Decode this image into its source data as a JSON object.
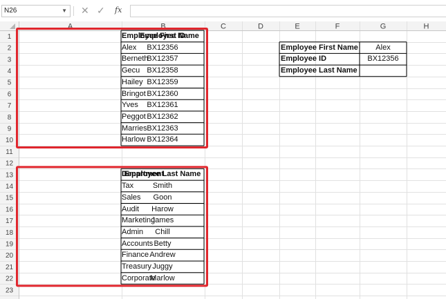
{
  "formula_bar": {
    "name_box": "N26",
    "cancel_icon": "x-icon",
    "enter_icon": "check-icon",
    "function_label": "fx",
    "formula_value": ""
  },
  "sheet": {
    "columns": [
      "A",
      "B",
      "C",
      "D",
      "E",
      "F",
      "G",
      "H"
    ],
    "rows": [
      "1",
      "2",
      "3",
      "4",
      "5",
      "6",
      "7",
      "8",
      "9",
      "10",
      "11",
      "12",
      "13",
      "14",
      "15",
      "16",
      "17",
      "18",
      "19",
      "20",
      "21",
      "22",
      "23"
    ],
    "table1": {
      "headers": [
        "Employee First Name",
        "Employee ID"
      ],
      "rows": [
        [
          "Alex",
          "BX12356"
        ],
        [
          "Berneth",
          "BX12357"
        ],
        [
          "Gecu",
          "BX12358"
        ],
        [
          "Hailey",
          "BX12359"
        ],
        [
          "Bringot",
          "BX12360"
        ],
        [
          "Yves",
          "BX12361"
        ],
        [
          "Peggot",
          "BX12362"
        ],
        [
          "Marries",
          "BX12363"
        ],
        [
          "Harlow",
          "BX12364"
        ]
      ]
    },
    "table2": {
      "headers": [
        "Department",
        "Employee Last Name"
      ],
      "rows": [
        [
          "Tax",
          "Smith"
        ],
        [
          "Sales",
          "Goon"
        ],
        [
          "Audit",
          "Harow"
        ],
        [
          "Marketing",
          "James"
        ],
        [
          "Admin",
          "Chill"
        ],
        [
          "Accounts",
          "Betty"
        ],
        [
          "Finance",
          "Andrew"
        ],
        [
          "Treasury",
          "Juggy"
        ],
        [
          "Corporate",
          "Marlow"
        ]
      ]
    },
    "lookup": {
      "rows": [
        [
          "Employee First Name",
          "Alex"
        ],
        [
          "Employee ID",
          "BX12356"
        ],
        [
          "Employee Last Name",
          ""
        ]
      ]
    },
    "colors": {
      "highlight_border": "#e0262d",
      "table_border": "#000000",
      "gridline": "#e1e1e1",
      "header_bg": "#f3f3f3",
      "selected_header_bg": "#d6d6d6"
    }
  }
}
